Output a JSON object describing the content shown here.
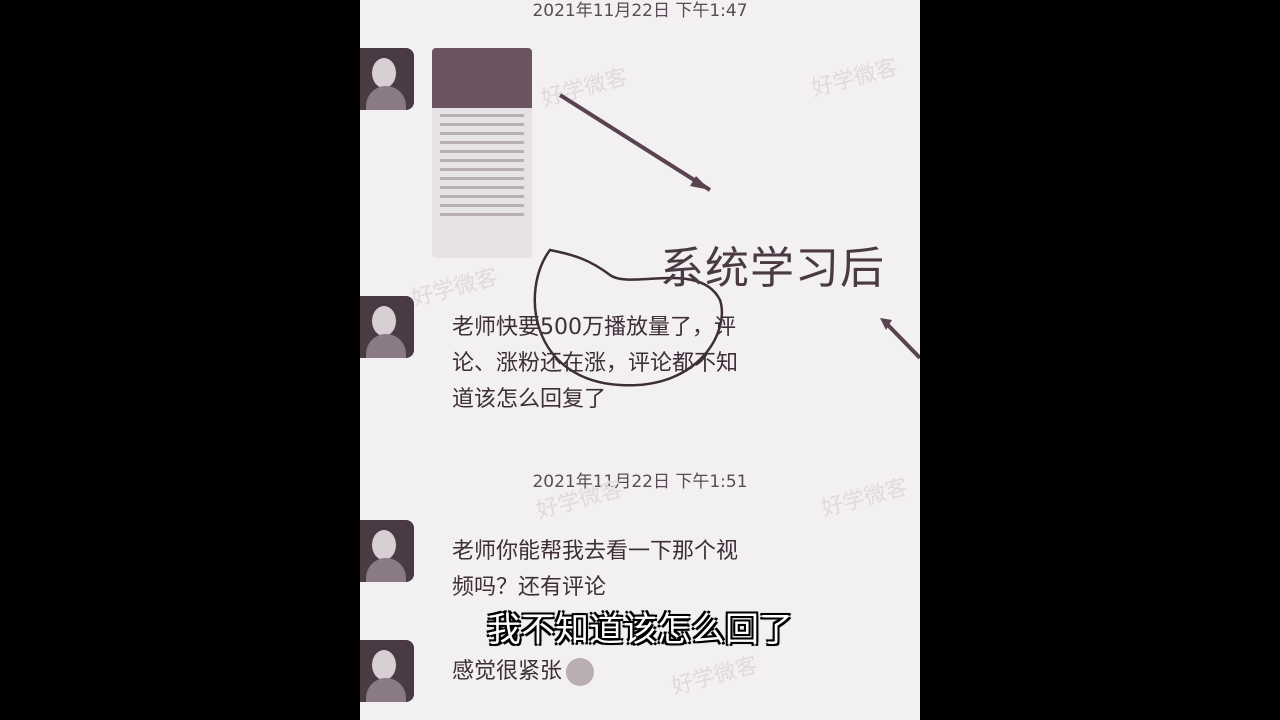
{
  "chat": {
    "timestamp_1": "2021年11月22日 下午1:47",
    "timestamp_2": "2021年11月22日 下午1:51",
    "messages": [
      {
        "text": "老师快要500万播放量了，评\n论、涨粉还在涨，评论都不知\n道该怎么回复了"
      },
      {
        "text": "老师你能帮我去看一下那个视\n频吗？还有评论"
      },
      {
        "text": "感觉很紧张"
      }
    ]
  },
  "annotation": {
    "label": "系统学习后"
  },
  "watermark": {
    "text": "好学微客"
  },
  "subtitle": {
    "text": "我不知道该怎么回了"
  },
  "colors": {
    "background": "#000000",
    "chat_bg": "#f3f0f1",
    "annotation": "#4a3a44"
  }
}
